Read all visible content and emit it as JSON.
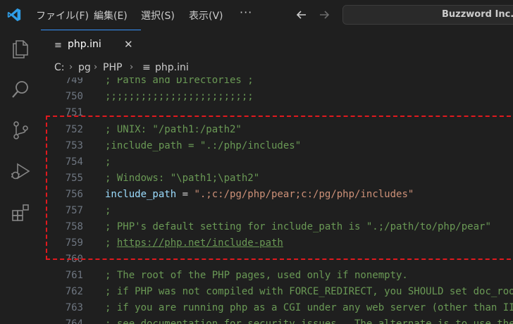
{
  "menu": {
    "file": "ファイル(F)",
    "edit": "編集(E)",
    "selection": "選択(S)",
    "view": "表示(V)",
    "more": "···"
  },
  "search": {
    "text": "Buzzword Inc."
  },
  "tab": {
    "label": "php.ini",
    "close": "✕",
    "icon": "≡"
  },
  "breadcrumb": {
    "drive": "C:",
    "folder1": "pg",
    "folder2": "PHP",
    "file": "php.ini"
  },
  "icons": {
    "logo": "vscode-logo-icon",
    "explorer": "files-icon",
    "search": "search-icon",
    "scm": "source-control-icon",
    "debug": "run-debug-icon",
    "extensions": "extensions-icon"
  },
  "colors": {
    "accent": "#3794ff",
    "comment": "#6a9955",
    "variable": "#9cdcfe",
    "string": "#ce9178",
    "highlight": "#e0191e"
  },
  "lines": [
    {
      "n": "749",
      "text": "; Paths and Directories ;"
    },
    {
      "n": "750",
      "text": ";;;;;;;;;;;;;;;;;;;;;;;;;"
    },
    {
      "n": "751",
      "text": ""
    },
    {
      "n": "752",
      "text": "; UNIX: \"/path1:/path2\""
    },
    {
      "n": "753",
      "text": ";include_path = \".:/php/includes\""
    },
    {
      "n": "754",
      "text": ";"
    },
    {
      "n": "755",
      "text": "; Windows: \"\\path1;\\path2\""
    },
    {
      "n": "756",
      "var": "include_path",
      "op": " = ",
      "str": "\".;c:/pg/php/pear;c:/pg/php/includes\""
    },
    {
      "n": "757",
      "text": ";"
    },
    {
      "n": "758",
      "text": "; PHP's default setting for include_path is \".;/path/to/php/pear\""
    },
    {
      "n": "759",
      "prefix": "; ",
      "link": "https://php.net/include-path"
    },
    {
      "n": "760",
      "text": ""
    },
    {
      "n": "761",
      "text": "; The root of the PHP pages, used only if nonempty."
    },
    {
      "n": "762",
      "text": "; if PHP was not compiled with FORCE_REDIRECT, you SHOULD set doc_root"
    },
    {
      "n": "763",
      "text": "; if you are running php as a CGI under any web server (other than IIS)"
    },
    {
      "n": "764",
      "text": "; see documentation for security issues.  The alternate is to use the"
    }
  ]
}
